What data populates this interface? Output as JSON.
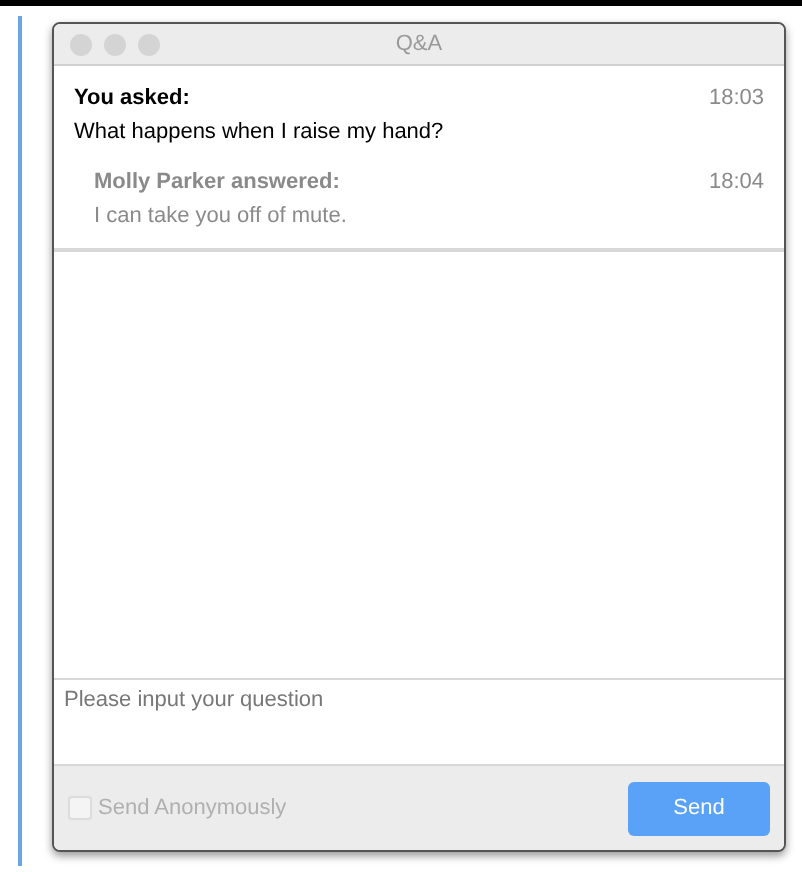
{
  "window": {
    "title": "Q&A"
  },
  "messages": [
    {
      "heading": "You asked:",
      "time": "18:03",
      "body": "What happens when I raise my hand?",
      "kind": "question"
    },
    {
      "heading": "Molly Parker answered:",
      "time": "18:04",
      "body": "I can take you off of mute.",
      "kind": "answer"
    }
  ],
  "question_input": {
    "placeholder": "Please input your question"
  },
  "anonymous": {
    "label": "Send Anonymously",
    "checked": false,
    "disabled": true
  },
  "send_button": {
    "label": "Send"
  }
}
